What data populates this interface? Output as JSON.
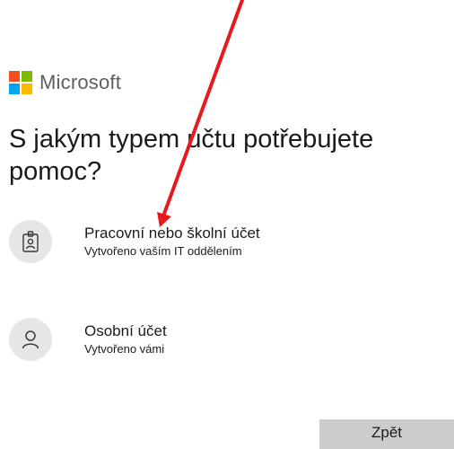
{
  "brand": {
    "name": "Microsoft",
    "colors": [
      "#f25022",
      "#7fba00",
      "#00a4ef",
      "#ffb900"
    ]
  },
  "title": "S jakým typem účtu potřebujete pomoc?",
  "options": [
    {
      "icon": "badge-icon",
      "title": "Pracovní nebo školní účet",
      "subtitle": "Vytvořeno vaším IT oddělením"
    },
    {
      "icon": "person-icon",
      "title": "Osobní účet",
      "subtitle": "Vytvořeno vámi"
    }
  ],
  "back_label": "Zpět",
  "annotation": {
    "color": "#e8191d"
  }
}
